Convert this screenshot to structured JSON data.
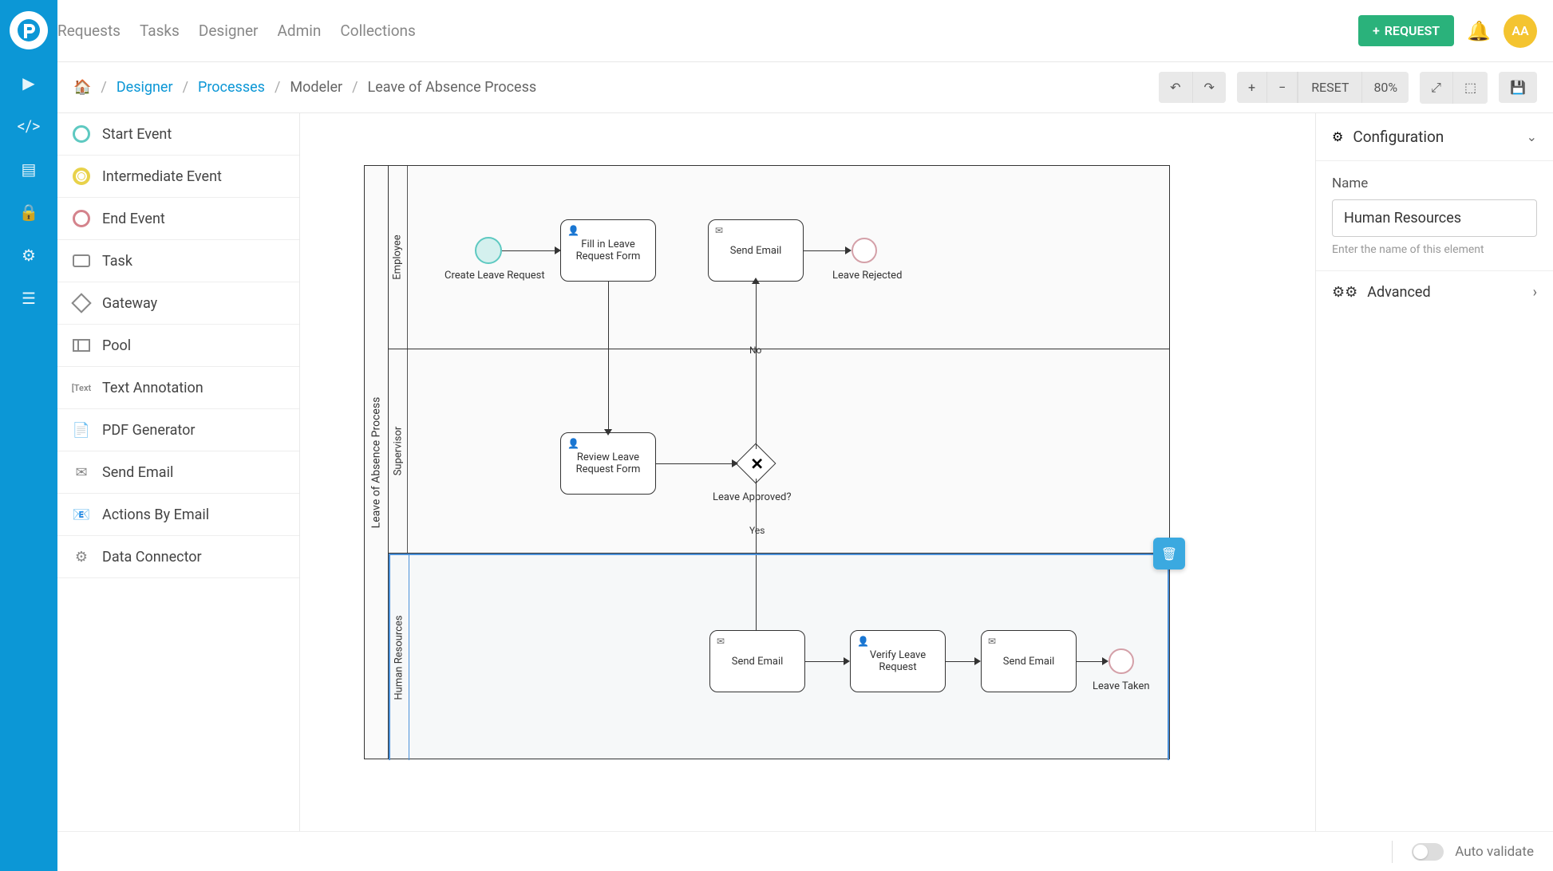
{
  "nav": {
    "requests": "Requests",
    "tasks": "Tasks",
    "designer": "Designer",
    "admin": "Admin",
    "collections": "Collections"
  },
  "topbar": {
    "request_btn": "REQUEST",
    "avatar": "AA"
  },
  "breadcrumb": {
    "designer": "Designer",
    "processes": "Processes",
    "modeler": "Modeler",
    "current": "Leave of Absence Process"
  },
  "controls": {
    "reset": "RESET",
    "zoom": "80%"
  },
  "palette": {
    "start_event": "Start Event",
    "intermediate_event": "Intermediate Event",
    "end_event": "End Event",
    "task": "Task",
    "gateway": "Gateway",
    "pool": "Pool",
    "text_annotation": "Text Annotation",
    "pdf_generator": "PDF Generator",
    "send_email": "Send Email",
    "actions_by_email": "Actions By Email",
    "data_connector": "Data Connector"
  },
  "diagram": {
    "pool_title": "Leave of Absence Process",
    "lane1": "Employee",
    "lane2": "Supervisor",
    "lane3": "Human Resources",
    "create_leave": "Create Leave Request",
    "fill_form": "Fill in Leave Request Form",
    "send_email1": "Send Email",
    "leave_rejected": "Leave Rejected",
    "review_form": "Review Leave Request Form",
    "leave_approved_q": "Leave Approved?",
    "edge_no": "No",
    "edge_yes": "Yes",
    "send_email2": "Send Email",
    "verify_leave": "Verify Leave Request",
    "send_email3": "Send Email",
    "leave_taken": "Leave Taken"
  },
  "panel": {
    "config_title": "Configuration",
    "name_label": "Name",
    "name_value": "Human Resources",
    "name_hint": "Enter the name of this element",
    "advanced": "Advanced"
  },
  "footer": {
    "auto_validate": "Auto validate"
  }
}
